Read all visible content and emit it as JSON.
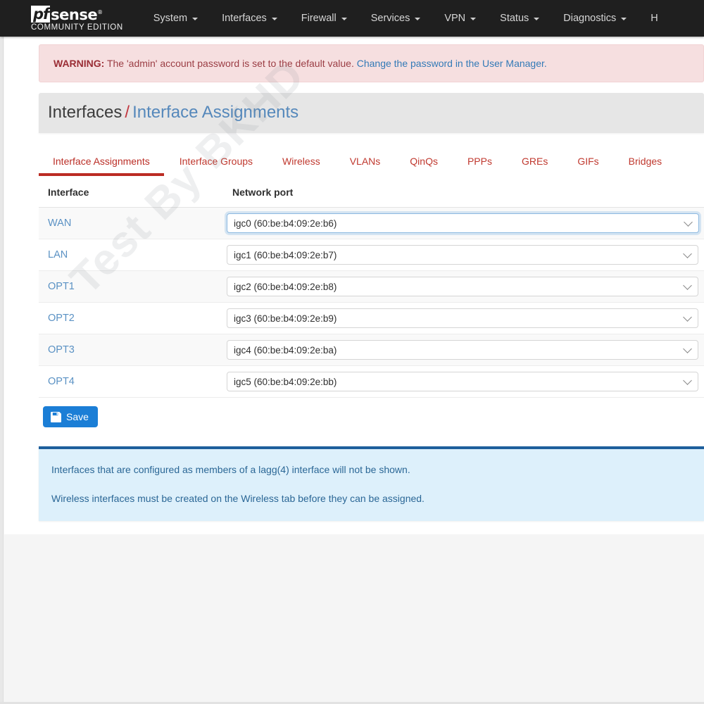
{
  "navbar": {
    "brand": {
      "pf": "pf",
      "sense": "sense",
      "subtitle": "COMMUNITY EDITION"
    },
    "items": [
      {
        "label": "System",
        "caret": true
      },
      {
        "label": "Interfaces",
        "caret": true
      },
      {
        "label": "Firewall",
        "caret": true
      },
      {
        "label": "Services",
        "caret": true
      },
      {
        "label": "VPN",
        "caret": true
      },
      {
        "label": "Status",
        "caret": true
      },
      {
        "label": "Diagnostics",
        "caret": true
      },
      {
        "label": "H",
        "caret": false
      }
    ]
  },
  "alert": {
    "prefix": "WARNING:",
    "text": "The 'admin' account password is set to the default value.",
    "link": "Change the password in the User Manager."
  },
  "breadcrumb": {
    "parent": "Interfaces",
    "separator": "/",
    "current": "Interface Assignments"
  },
  "tabs": [
    {
      "label": "Interface Assignments",
      "active": true
    },
    {
      "label": "Interface Groups",
      "active": false
    },
    {
      "label": "Wireless",
      "active": false
    },
    {
      "label": "VLANs",
      "active": false
    },
    {
      "label": "QinQs",
      "active": false
    },
    {
      "label": "PPPs",
      "active": false
    },
    {
      "label": "GREs",
      "active": false
    },
    {
      "label": "GIFs",
      "active": false
    },
    {
      "label": "Bridges",
      "active": false
    }
  ],
  "table": {
    "headers": {
      "interface": "Interface",
      "network_port": "Network port"
    },
    "rows": [
      {
        "interface": "WAN",
        "port": "igc0 (60:be:b4:09:2e:b6)",
        "focused": true
      },
      {
        "interface": "LAN",
        "port": "igc1 (60:be:b4:09:2e:b7)",
        "focused": false
      },
      {
        "interface": "OPT1",
        "port": "igc2 (60:be:b4:09:2e:b8)",
        "focused": false
      },
      {
        "interface": "OPT2",
        "port": "igc3 (60:be:b4:09:2e:b9)",
        "focused": false
      },
      {
        "interface": "OPT3",
        "port": "igc4 (60:be:b4:09:2e:ba)",
        "focused": false
      },
      {
        "interface": "OPT4",
        "port": "igc5 (60:be:b4:09:2e:bb)",
        "focused": false
      }
    ]
  },
  "save_button": {
    "label": "Save",
    "icon": "save-floppy-icon"
  },
  "info_panel": {
    "lines": [
      "Interfaces that are configured as members of a lagg(4) interface will not be shown.",
      "Wireless interfaces must be created on the Wireless tab before they can be assigned."
    ]
  },
  "watermark": {
    "text": "Test By BKHD"
  },
  "colors": {
    "navbar_bg": "#1f1f1f",
    "accent_red": "#bb2c23",
    "link_blue": "#5b92c4",
    "primary_blue": "#1b7ed6",
    "info_border": "#1e5f9c",
    "info_bg": "#ddf0fb",
    "warning_bg": "#f6dfe0"
  }
}
